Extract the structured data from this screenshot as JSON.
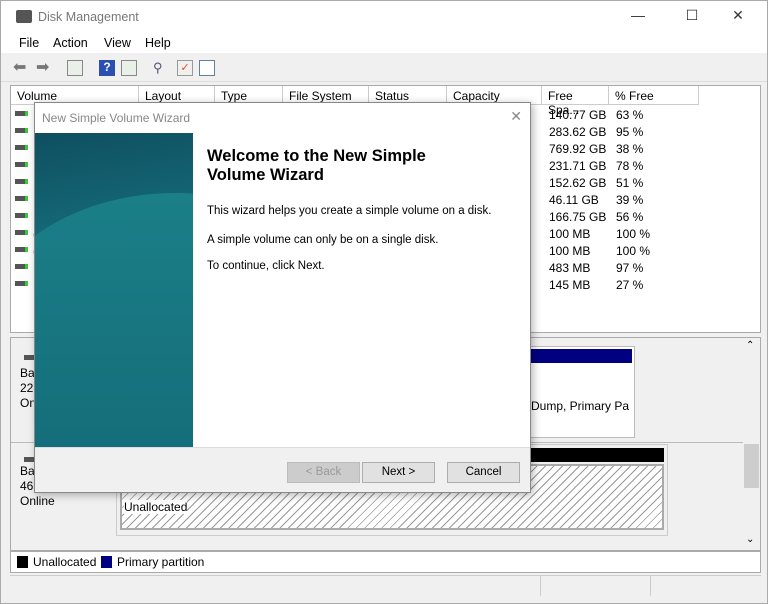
{
  "window": {
    "title": "Disk Management"
  },
  "menu": [
    "File",
    "Action",
    "View",
    "Help"
  ],
  "toolbar": [
    "back-icon",
    "forward-icon",
    "show-hide-console-tree-icon",
    "help-icon",
    "show-hide-action-pane-icon",
    "connect-icon",
    "checklist-icon",
    "properties-icon"
  ],
  "table": {
    "columns": [
      "Volume",
      "Layout",
      "Type",
      "File System",
      "Status",
      "Capacity",
      "Free Spa...",
      "% Free"
    ],
    "rows": [
      {
        "volume": "",
        "free": "140.77 GB",
        "pct": "63 %"
      },
      {
        "volume": "",
        "free": "283.62 GB",
        "pct": "95 %"
      },
      {
        "volume": "",
        "free": "769.92 GB",
        "pct": "38 %"
      },
      {
        "volume": "",
        "free": "231.71 GB",
        "pct": "78 %"
      },
      {
        "volume": "",
        "free": "152.62 GB",
        "pct": "51 %"
      },
      {
        "volume": "",
        "free": "46.11 GB",
        "pct": "39 %"
      },
      {
        "volume": "",
        "free": "166.75 GB",
        "pct": "56 %"
      },
      {
        "volume": "(",
        "free": "100 MB",
        "pct": "100 %"
      },
      {
        "volume": "(",
        "free": "100 MB",
        "pct": "100 %"
      },
      {
        "volume": "F",
        "free": "483 MB",
        "pct": "97 %"
      },
      {
        "volume": "F",
        "free": "145 MB",
        "pct": "27 %"
      }
    ]
  },
  "disks": [
    {
      "lines": [
        "Bas",
        "223",
        "On"
      ],
      "partition_text": "Dump, Primary Pa"
    },
    {
      "lines": [
        "Bas",
        "465",
        "Online"
      ],
      "partition_text": "Unallocated"
    }
  ],
  "legend": [
    {
      "label": "Unallocated",
      "color": "#000000"
    },
    {
      "label": "Primary partition",
      "color": "#000080"
    }
  ],
  "dialog": {
    "title": "New Simple Volume Wizard",
    "heading": "Welcome to the New Simple Volume Wizard",
    "p1": "This wizard helps you create a simple volume on a disk.",
    "p2": "A simple volume can only be on a single disk.",
    "p3": "To continue, click Next.",
    "back": "< Back",
    "next": "Next >",
    "cancel": "Cancel"
  }
}
